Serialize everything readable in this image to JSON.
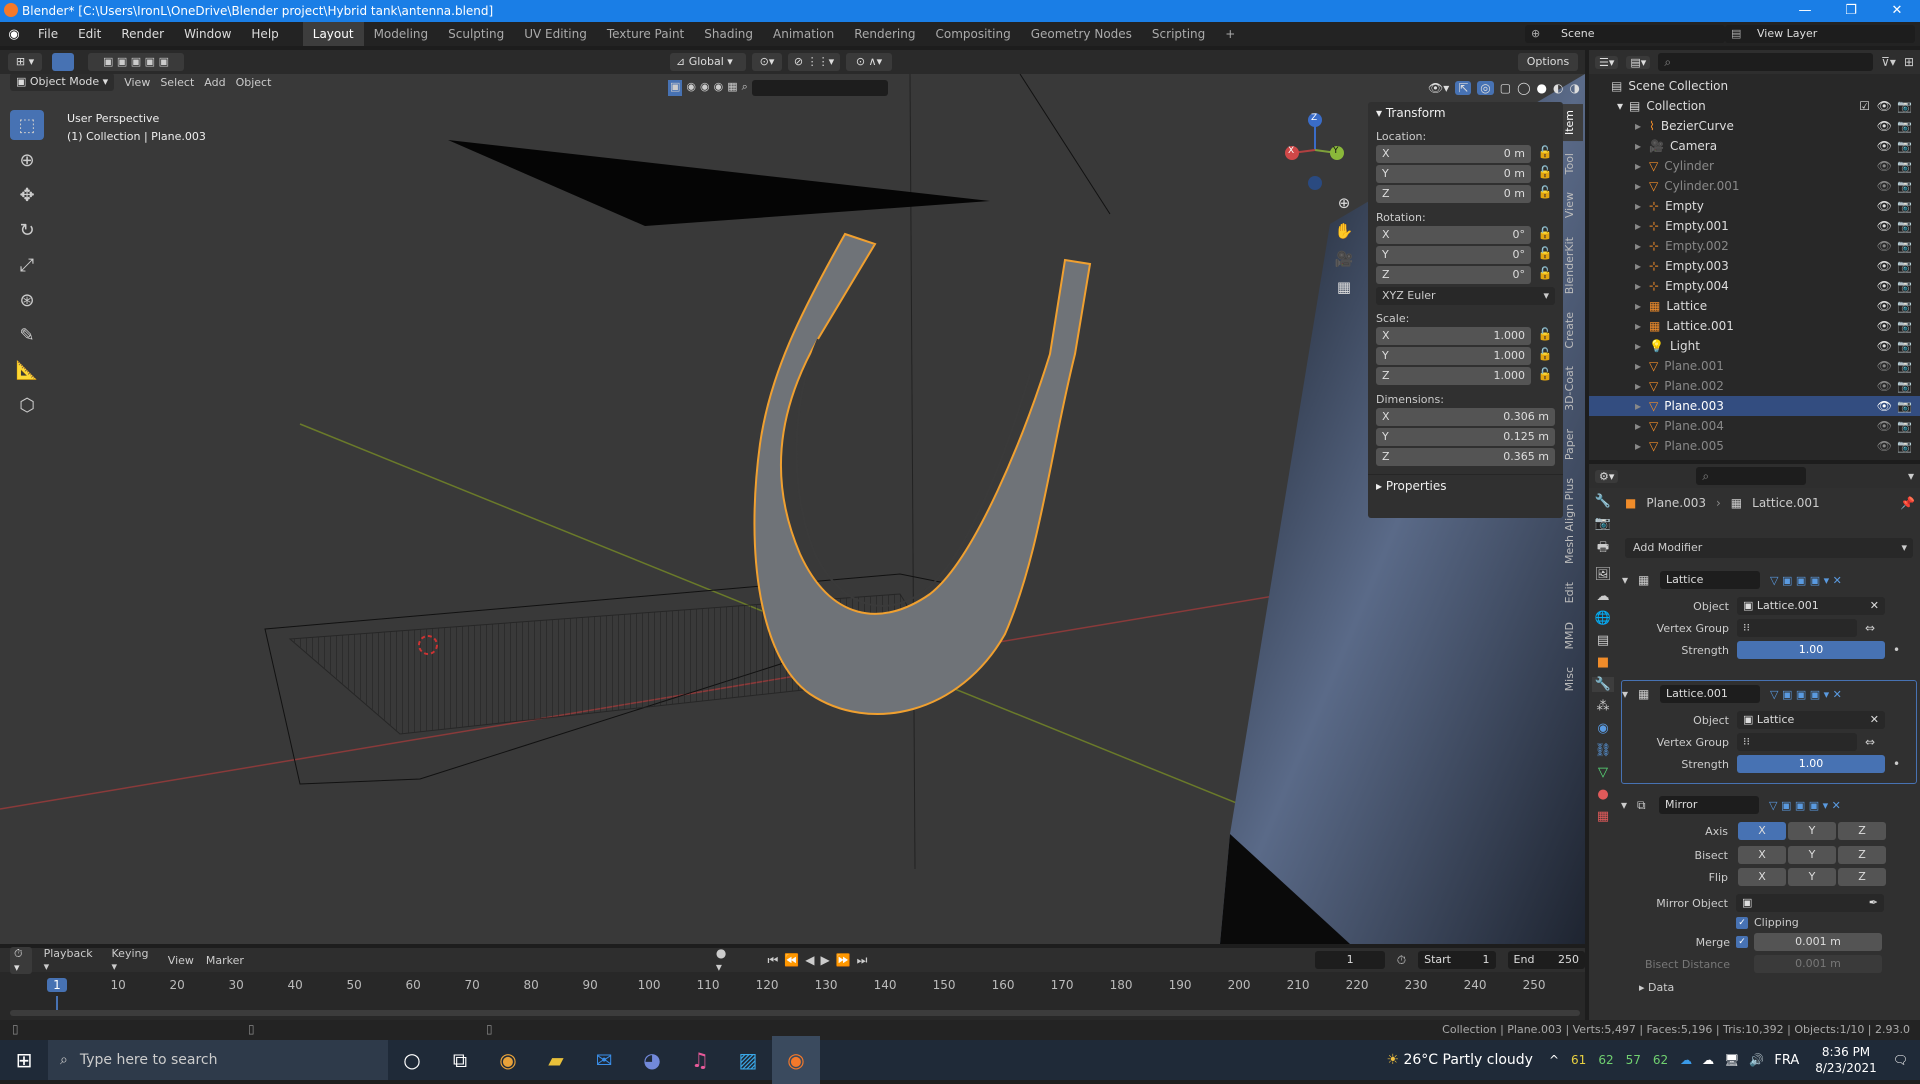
{
  "window": {
    "title": "Blender* [C:\\Users\\IronL\\OneDrive\\Blender project\\Hybrid tank\\antenna.blend]",
    "min": "—",
    "max": "❐",
    "close": "✕"
  },
  "menu": [
    "File",
    "Edit",
    "Render",
    "Window",
    "Help"
  ],
  "workspaces": [
    "Layout",
    "Modeling",
    "Sculpting",
    "UV Editing",
    "Texture Paint",
    "Shading",
    "Animation",
    "Rendering",
    "Compositing",
    "Geometry Nodes",
    "Scripting"
  ],
  "scene": {
    "label": "Scene",
    "view_layer": "View Layer"
  },
  "header": {
    "orientation": "Global",
    "options": "Options",
    "mode": "Object Mode",
    "view": "View",
    "select": "Select",
    "add": "Add",
    "object": "Object"
  },
  "viewport": {
    "perspective": "User Perspective",
    "collection": "(1) Collection | Plane.003",
    "gizmo": {
      "x": "X",
      "y": "Y",
      "z": "Z"
    }
  },
  "npanel": {
    "transform": "Transform",
    "location": "Location:",
    "rotation": "Rotation:",
    "scale": "Scale:",
    "dimensions": "Dimensions:",
    "euler": "XYZ Euler",
    "properties": "Properties",
    "loc": [
      {
        "a": "X",
        "v": "0 m"
      },
      {
        "a": "Y",
        "v": "0 m"
      },
      {
        "a": "Z",
        "v": "0 m"
      }
    ],
    "rot": [
      {
        "a": "X",
        "v": "0°"
      },
      {
        "a": "Y",
        "v": "0°"
      },
      {
        "a": "Z",
        "v": "0°"
      }
    ],
    "scl": [
      {
        "a": "X",
        "v": "1.000"
      },
      {
        "a": "Y",
        "v": "1.000"
      },
      {
        "a": "Z",
        "v": "1.000"
      }
    ],
    "dim": [
      {
        "a": "X",
        "v": "0.306 m"
      },
      {
        "a": "Y",
        "v": "0.125 m"
      },
      {
        "a": "Z",
        "v": "0.365 m"
      }
    ],
    "tabs": [
      "Item",
      "Tool",
      "View",
      "BlenderKit",
      "Create",
      "3D-Coat",
      "Paper",
      "Mesh Align Plus",
      "Edit",
      "MMD",
      "Misc"
    ]
  },
  "outliner": {
    "scene_collection": "Scene Collection",
    "collection": "Collection",
    "items": [
      {
        "name": "BezierCurve",
        "dim": false,
        "sel": false
      },
      {
        "name": "Camera",
        "dim": false,
        "sel": false
      },
      {
        "name": "Cylinder",
        "dim": true,
        "sel": false
      },
      {
        "name": "Cylinder.001",
        "dim": true,
        "sel": false
      },
      {
        "name": "Empty",
        "dim": false,
        "sel": false
      },
      {
        "name": "Empty.001",
        "dim": false,
        "sel": false
      },
      {
        "name": "Empty.002",
        "dim": true,
        "sel": false
      },
      {
        "name": "Empty.003",
        "dim": false,
        "sel": false
      },
      {
        "name": "Empty.004",
        "dim": false,
        "sel": false
      },
      {
        "name": "Lattice",
        "dim": false,
        "sel": false
      },
      {
        "name": "Lattice.001",
        "dim": false,
        "sel": false
      },
      {
        "name": "Light",
        "dim": false,
        "sel": false
      },
      {
        "name": "Plane.001",
        "dim": true,
        "sel": false
      },
      {
        "name": "Plane.002",
        "dim": true,
        "sel": false
      },
      {
        "name": "Plane.003",
        "dim": true,
        "sel": true
      },
      {
        "name": "Plane.004",
        "dim": true,
        "sel": false
      },
      {
        "name": "Plane.005",
        "dim": true,
        "sel": false
      }
    ]
  },
  "properties": {
    "object": "Plane.003",
    "modifier_target": "Lattice.001",
    "add_modifier": "Add Modifier",
    "mods": [
      {
        "name": "Lattice",
        "object_label": "Object",
        "object": "Lattice.001",
        "vg_label": "Vertex Group",
        "strength_label": "Strength",
        "strength": "1.00"
      },
      {
        "name": "Lattice.001",
        "object_label": "Object",
        "object": "Lattice",
        "vg_label": "Vertex Group",
        "strength_label": "Strength",
        "strength": "1.00"
      }
    ],
    "mirror": {
      "name": "Mirror",
      "axis": "Axis",
      "bisect": "Bisect",
      "flip": "Flip",
      "x": "X",
      "y": "Y",
      "z": "Z",
      "mirror_object": "Mirror Object",
      "clipping": "Clipping",
      "merge": "Merge",
      "merge_val": "0.001 m",
      "bisect_distance": "Bisect Distance",
      "bisect_val": "0.001 m",
      "data": "Data"
    }
  },
  "timeline": {
    "playback": "Playback",
    "keying": "Keying",
    "view": "View",
    "marker": "Marker",
    "current": "1",
    "start_label": "Start",
    "start": "1",
    "end_label": "End",
    "end": "250",
    "ticks": [
      "1",
      "10",
      "20",
      "30",
      "40",
      "50",
      "60",
      "70",
      "80",
      "90",
      "100",
      "110",
      "120",
      "130",
      "140",
      "150",
      "160",
      "170",
      "180",
      "190",
      "200",
      "210",
      "220",
      "230",
      "240",
      "250"
    ]
  },
  "status": {
    "text": "Collection | Plane.003 | Verts:5,497 | Faces:5,196 | Tris:10,392 | Objects:1/10 | 2.93.0"
  },
  "taskbar": {
    "search": "Type here to search",
    "weather": "26°C  Partly cloudy",
    "nums": [
      "61",
      "62",
      "57",
      "62"
    ],
    "lang": "FRA",
    "time": "8:36 PM",
    "date": "8/23/2021"
  }
}
